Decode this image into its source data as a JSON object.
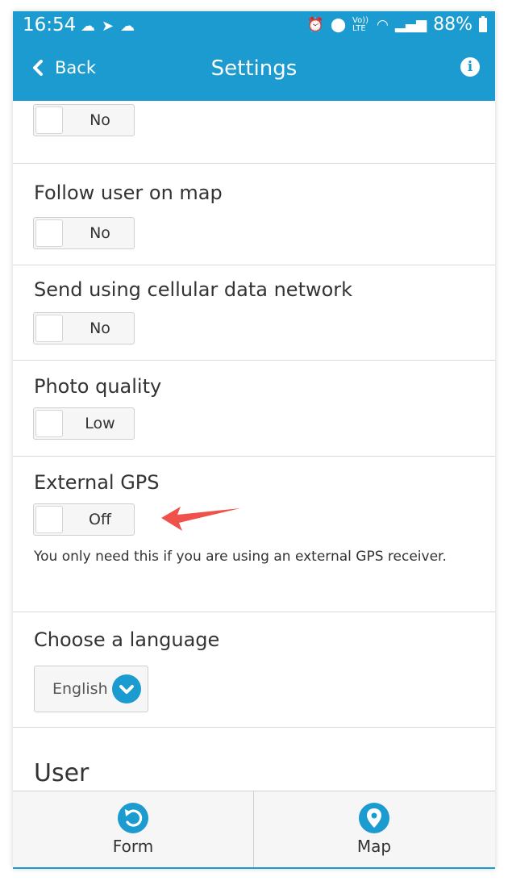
{
  "status_bar": {
    "time": "16:54",
    "battery": "88%",
    "volte": "Vo)) LTE"
  },
  "header": {
    "back_label": "Back",
    "title": "Settings"
  },
  "settings": [
    {
      "label": "",
      "value": "No"
    },
    {
      "label": "Follow user on map",
      "value": "No"
    },
    {
      "label": "Send using cellular data network",
      "value": "No"
    },
    {
      "label": "Photo quality",
      "value": "Low"
    },
    {
      "label": "External GPS",
      "value": "Off",
      "help": "You only need this if you are using an external GPS receiver."
    }
  ],
  "language": {
    "label": "Choose a language",
    "selected": "English"
  },
  "user_heading": "User",
  "bottom_nav": [
    {
      "label": "Form",
      "icon": "undo-icon"
    },
    {
      "label": "Map",
      "icon": "map-pin-icon"
    }
  ],
  "colors": {
    "accent": "#1b9bcf",
    "annotation_arrow": "#f0514a"
  }
}
